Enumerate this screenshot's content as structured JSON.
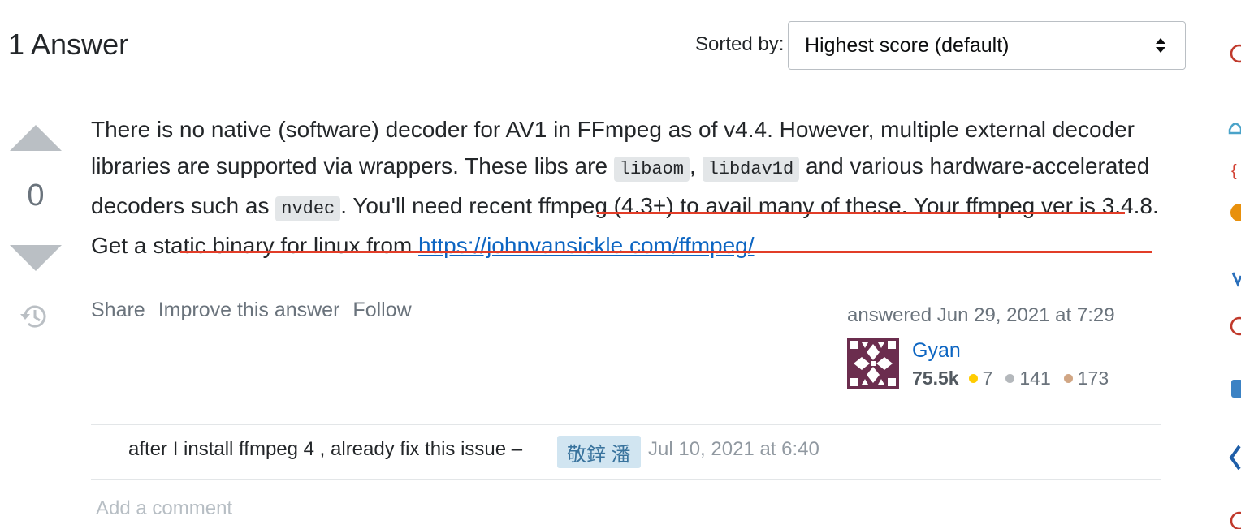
{
  "header": {
    "answers_count": "1 Answer",
    "sort_label": "Sorted by:",
    "sort_value": "Highest score (default)"
  },
  "vote": {
    "count": "0"
  },
  "answer": {
    "text_1": "There is no native (software) decoder for AV1 in FFmpeg as of v4.4. However, multiple external decoder libraries are supported via wrappers. These libs are ",
    "code_1": "libaom",
    "text_2": ", ",
    "code_2": "libdav1d",
    "text_3": " and various hardware-accelerated decoders such as ",
    "code_3": "nvdec",
    "text_4": ". You'll need recent ffmpeg (4.3+) to avail many of these. Your ffmpeg ver is 3.4.8. Get a static binary for linux from ",
    "link": "https://johnvansickle.com/ffmpeg/"
  },
  "post_menu": {
    "share": "Share",
    "improve": "Improve this answer",
    "follow": "Follow"
  },
  "user_card": {
    "answered_time": "answered Jun 29, 2021 at 7:29",
    "name": "Gyan",
    "reputation": "75.5k",
    "gold": "7",
    "silver": "141",
    "bronze": "173",
    "gold_color": "#ffcc01",
    "silver_color": "#b4b8bc",
    "bronze_color": "#d1a684"
  },
  "comment": {
    "text": "after I install ffmpeg 4 , already fix this issue –",
    "user": "敬鋅 潘",
    "date": "Jul 10, 2021 at 6:40"
  },
  "add_comment": "Add a comment",
  "colors": {
    "link": "#0c65c2",
    "annotation_underline": "#e23d28"
  }
}
